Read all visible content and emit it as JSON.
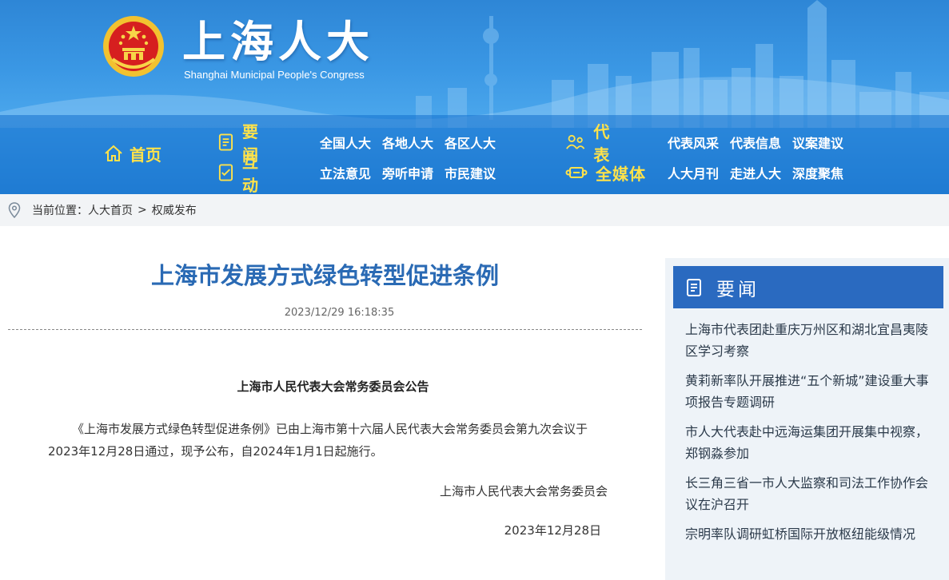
{
  "header": {
    "title": "上海人大",
    "subtitle": "Shanghai Municipal People's Congress"
  },
  "nav": {
    "home": {
      "label": "首页",
      "icon": "home-icon"
    },
    "groups": [
      {
        "title": "要　闻",
        "icon": "news-icon",
        "links": [
          "全国人大",
          "各地人大",
          "各区人大"
        ]
      },
      {
        "title": "代　表",
        "icon": "people-icon",
        "links": [
          "代表风采",
          "代表信息",
          "议案建议"
        ]
      },
      {
        "title": "互　动",
        "icon": "checklist-icon",
        "links": [
          "立法意见",
          "旁听申请",
          "市民建议"
        ]
      },
      {
        "title": "全媒体",
        "icon": "media-icon",
        "links": [
          "人大月刊",
          "走进人大",
          "深度聚焦"
        ]
      }
    ]
  },
  "breadcrumb": {
    "prefix": "当前位置：",
    "items": [
      "人大首页",
      "权威发布"
    ],
    "separator": ">"
  },
  "article": {
    "title": "上海市发展方式绿色转型促进条例",
    "datetime": "2023/12/29 16:18:35",
    "notice_title": "上海市人民代表大会常务委员会公告",
    "body": "《上海市发展方式绿色转型促进条例》已由上海市第十六届人民代表大会常务委员会第九次会议于2023年12月28日通过，现予公布，自2024年1月1日起施行。",
    "signer": "上海市人民代表大会常务委员会",
    "date": "2023年12月28日"
  },
  "sidebar": {
    "title": "要闻",
    "items": [
      "上海市代表团赴重庆万州区和湖北宜昌夷陵区学习考察",
      "黄莉新率队开展推进“五个新城”建设重大事项报告专题调研",
      "市人大代表赴中远海运集团开展集中视察，郑钢淼参加",
      "长三角三省一市人大监察和司法工作协作会议在沪召开",
      "宗明率队调研虹桥国际开放枢纽能级情况"
    ]
  },
  "colors": {
    "banner_blue": "#2e86d6",
    "nav_yellow": "#ffe24a",
    "title_blue": "#2a6ab4",
    "sidebar_header": "#2a6ac0",
    "sidebar_bg": "#eef3f8"
  }
}
